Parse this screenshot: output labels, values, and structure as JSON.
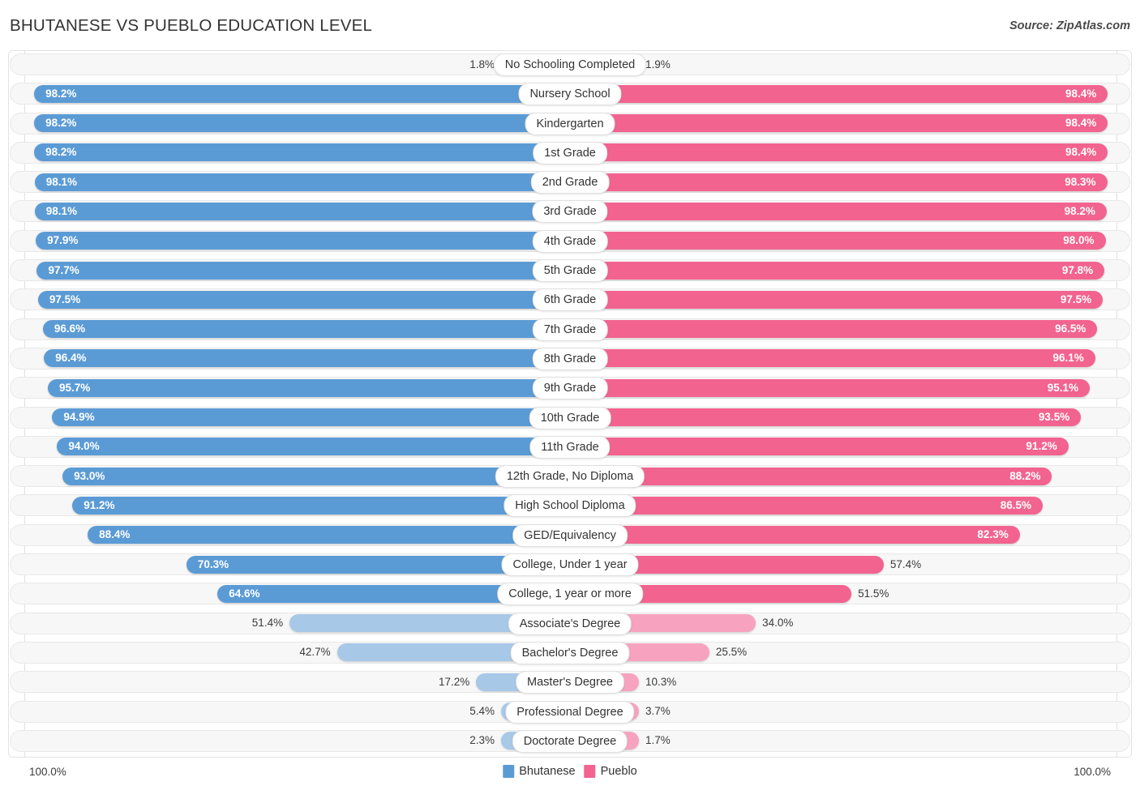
{
  "header": {
    "title": "BHUTANESE VS PUEBLO EDUCATION LEVEL",
    "source": "Source: ZipAtlas.com"
  },
  "axis": {
    "left_max_label": "100.0%",
    "right_max_label": "100.0%"
  },
  "legend": {
    "items": [
      {
        "label": "Bhutanese",
        "color": "#5b9bd5"
      },
      {
        "label": "Pueblo",
        "color": "#f2638f"
      }
    ]
  },
  "colors": {
    "bhutanese_strong": "#5b9bd5",
    "bhutanese_light": "#a8c8e8",
    "pueblo_strong": "#f2638f",
    "pueblo_light": "#f7a3bf",
    "track": "#f7f7f7",
    "track_border": "#e8e8e8",
    "gridline": "#e0e0e0"
  },
  "chart_data": {
    "type": "bar",
    "title": "BHUTANESE VS PUEBLO EDUCATION LEVEL",
    "subtitle": "",
    "xlabel": "",
    "ylabel": "",
    "orientation": "horizontal-diverging",
    "xlim": [
      0,
      100
    ],
    "grid": true,
    "legend_position": "bottom-center",
    "categories": [
      "No Schooling Completed",
      "Nursery School",
      "Kindergarten",
      "1st Grade",
      "2nd Grade",
      "3rd Grade",
      "4th Grade",
      "5th Grade",
      "6th Grade",
      "7th Grade",
      "8th Grade",
      "9th Grade",
      "10th Grade",
      "11th Grade",
      "12th Grade, No Diploma",
      "High School Diploma",
      "GED/Equivalency",
      "College, Under 1 year",
      "College, 1 year or more",
      "Associate's Degree",
      "Bachelor's Degree",
      "Master's Degree",
      "Professional Degree",
      "Doctorate Degree"
    ],
    "series": [
      {
        "name": "Bhutanese",
        "side": "left",
        "color": "#5b9bd5",
        "values": [
          1.8,
          98.2,
          98.2,
          98.2,
          98.1,
          98.1,
          97.9,
          97.7,
          97.5,
          96.6,
          96.4,
          95.7,
          94.9,
          94.0,
          93.0,
          91.2,
          88.4,
          70.3,
          64.6,
          51.4,
          42.7,
          17.2,
          5.4,
          2.3
        ],
        "labels": [
          "1.8%",
          "98.2%",
          "98.2%",
          "98.2%",
          "98.1%",
          "98.1%",
          "97.9%",
          "97.7%",
          "97.5%",
          "96.6%",
          "96.4%",
          "95.7%",
          "94.9%",
          "94.0%",
          "93.0%",
          "91.2%",
          "88.4%",
          "70.3%",
          "64.6%",
          "51.4%",
          "42.7%",
          "17.2%",
          "5.4%",
          "2.3%"
        ]
      },
      {
        "name": "Pueblo",
        "side": "right",
        "color": "#f2638f",
        "values": [
          1.9,
          98.4,
          98.4,
          98.4,
          98.3,
          98.2,
          98.0,
          97.8,
          97.5,
          96.5,
          96.1,
          95.1,
          93.5,
          91.2,
          88.2,
          86.5,
          82.3,
          57.4,
          51.5,
          34.0,
          25.5,
          10.3,
          3.7,
          1.7
        ],
        "labels": [
          "1.9%",
          "98.4%",
          "98.4%",
          "98.4%",
          "98.3%",
          "98.2%",
          "98.0%",
          "97.8%",
          "97.5%",
          "96.5%",
          "96.1%",
          "95.1%",
          "93.5%",
          "91.2%",
          "88.2%",
          "86.5%",
          "82.3%",
          "57.4%",
          "51.5%",
          "34.0%",
          "25.5%",
          "10.3%",
          "3.7%",
          "1.7%"
        ]
      }
    ]
  }
}
